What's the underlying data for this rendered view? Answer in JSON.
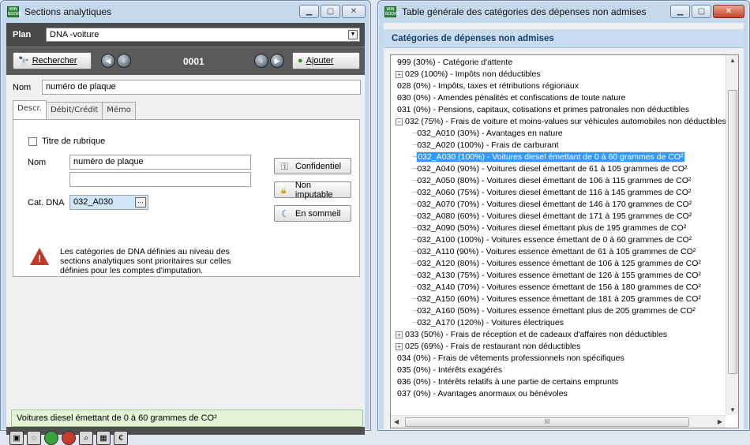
{
  "left_window": {
    "title": "Sections analytiques",
    "plan_label": "Plan",
    "plan_value": "DNA -voiture",
    "search_label": "Rechercher",
    "counter": "0001",
    "add_label": "Ajouter",
    "nom_label": "Nom",
    "nom_value": "numéro de plaque",
    "tabs": [
      "Descr.",
      "Débit/Crédit",
      "Mémo"
    ],
    "titre_rubrique_label": "Titre de rubrique",
    "inner_nom_label": "Nom",
    "inner_nom_value": "numéro de plaque",
    "inner_nom_value2": "",
    "cat_dna_label": "Cat. DNA",
    "cat_dna_value": "032_A030",
    "browse_label": "...",
    "confidentiel_label": "Confidentiel",
    "non_imputable_label": "Non imputable",
    "en_sommeil_label": "En sommeil",
    "warning_text": "Les catégories de DNA définies au niveau des sections analytiques sont prioritaires sur celles définies pour les comptes d'imputation.",
    "status_text": "Voitures diesel émettant de 0 à 60 grammes de CO²"
  },
  "right_window": {
    "title": "Table générale des catégories des dépenses non admises",
    "header": "Catégories de dépenses non admises",
    "tree": [
      {
        "level": 0,
        "expander": "",
        "label": "999 (30%) - Catégorie d'attente"
      },
      {
        "level": 0,
        "expander": "+",
        "label": "029 (100%) - Impôts non déductibles"
      },
      {
        "level": 0,
        "expander": "",
        "label": "028 (0%) - Impôts, taxes et rétributions régionaux"
      },
      {
        "level": 0,
        "expander": "",
        "label": "030 (0%) - Amendes pénalités et confiscations de toute nature"
      },
      {
        "level": 0,
        "expander": "",
        "label": "031 (0%) - Pensions, capitaux, cotisations et primes patronales non déductibles"
      },
      {
        "level": 0,
        "expander": "−",
        "label": "032 (75%) - Frais de voiture et moins-values sur véhicules automobiles non déductibles"
      },
      {
        "level": 1,
        "expander": "",
        "label": "032_A010 (30%) - Avantages en nature"
      },
      {
        "level": 1,
        "expander": "",
        "label": "032_A020 (100%) - Frais de carburant"
      },
      {
        "level": 1,
        "expander": "",
        "label": "032_A030 (100%) - Voitures diesel émettant de 0 à 60 grammes de CO²",
        "selected": true
      },
      {
        "level": 1,
        "expander": "",
        "label": "032_A040 (90%) - Voitures diesel émettant de 61 à 105 grammes de CO²"
      },
      {
        "level": 1,
        "expander": "",
        "label": "032_A050 (80%) - Voitures diesel émettant de 106 à 115 grammes de CO²"
      },
      {
        "level": 1,
        "expander": "",
        "label": "032_A060 (75%) - Voitures diesel émettant de 116 à 145 grammes de CO²"
      },
      {
        "level": 1,
        "expander": "",
        "label": "032_A070 (70%) - Voitures diesel émettant de 146 à 170 grammes de CO²"
      },
      {
        "level": 1,
        "expander": "",
        "label": "032_A080 (60%) - Voitures diesel émettant de 171 à 195 grammes de CO²"
      },
      {
        "level": 1,
        "expander": "",
        "label": "032_A090 (50%) - Voitures diesel émettant plus de 195 grammes de CO²"
      },
      {
        "level": 1,
        "expander": "",
        "label": "032_A100 (100%) - Voitures essence émettant de 0 à 60 grammes de CO²"
      },
      {
        "level": 1,
        "expander": "",
        "label": "032_A110 (90%) - Voitures essence émettant de 61 à 105 grammes de CO²"
      },
      {
        "level": 1,
        "expander": "",
        "label": "032_A120 (80%) - Voitures essence émettant de 106 à 125 grammes de CO²"
      },
      {
        "level": 1,
        "expander": "",
        "label": "032_A130 (75%) - Voitures essence émettant de 126 à 155 grammes de CO²"
      },
      {
        "level": 1,
        "expander": "",
        "label": "032_A140 (70%) - Voitures essence émettant de 156 à 180 grammes de CO²"
      },
      {
        "level": 1,
        "expander": "",
        "label": "032_A150 (60%) - Voitures essence émettant de 181 à 205 grammes de CO²"
      },
      {
        "level": 1,
        "expander": "",
        "label": "032_A160 (50%) - Voitures essence émettant plus de 205 grammes de CO²"
      },
      {
        "level": 1,
        "expander": "",
        "label": "032_A170 (120%) - Voitures électriques"
      },
      {
        "level": 0,
        "expander": "+",
        "label": "033 (50%) - Frais de réception et de cadeaux d'affaires non déductibles"
      },
      {
        "level": 0,
        "expander": "+",
        "label": "025 (69%) - Frais de restaurant non déductibles"
      },
      {
        "level": 0,
        "expander": "",
        "label": "034 (0%) - Frais de vêtements professionnels non spécifiques"
      },
      {
        "level": 0,
        "expander": "",
        "label": "035 (0%) - Intérêts exagérés"
      },
      {
        "level": 0,
        "expander": "",
        "label": "036 (0%) - Intérêts relatifs à une partie de certains emprunts"
      },
      {
        "level": 0,
        "expander": "",
        "label": "037 (0%) - Avantages anormaux ou bénévoles"
      }
    ],
    "hscroll_grip": "III"
  },
  "icons": {
    "search": "binoculars-icon",
    "add": "add-green-icon",
    "key": "key-icon",
    "lock": "lock-icon",
    "moon": "moon-icon",
    "warning": "warning-icon"
  },
  "colors": {
    "selection": "#3399ff",
    "status_bg": "#e4f3d6",
    "header_text": "#1c3e66",
    "warning": "#c0392b"
  }
}
